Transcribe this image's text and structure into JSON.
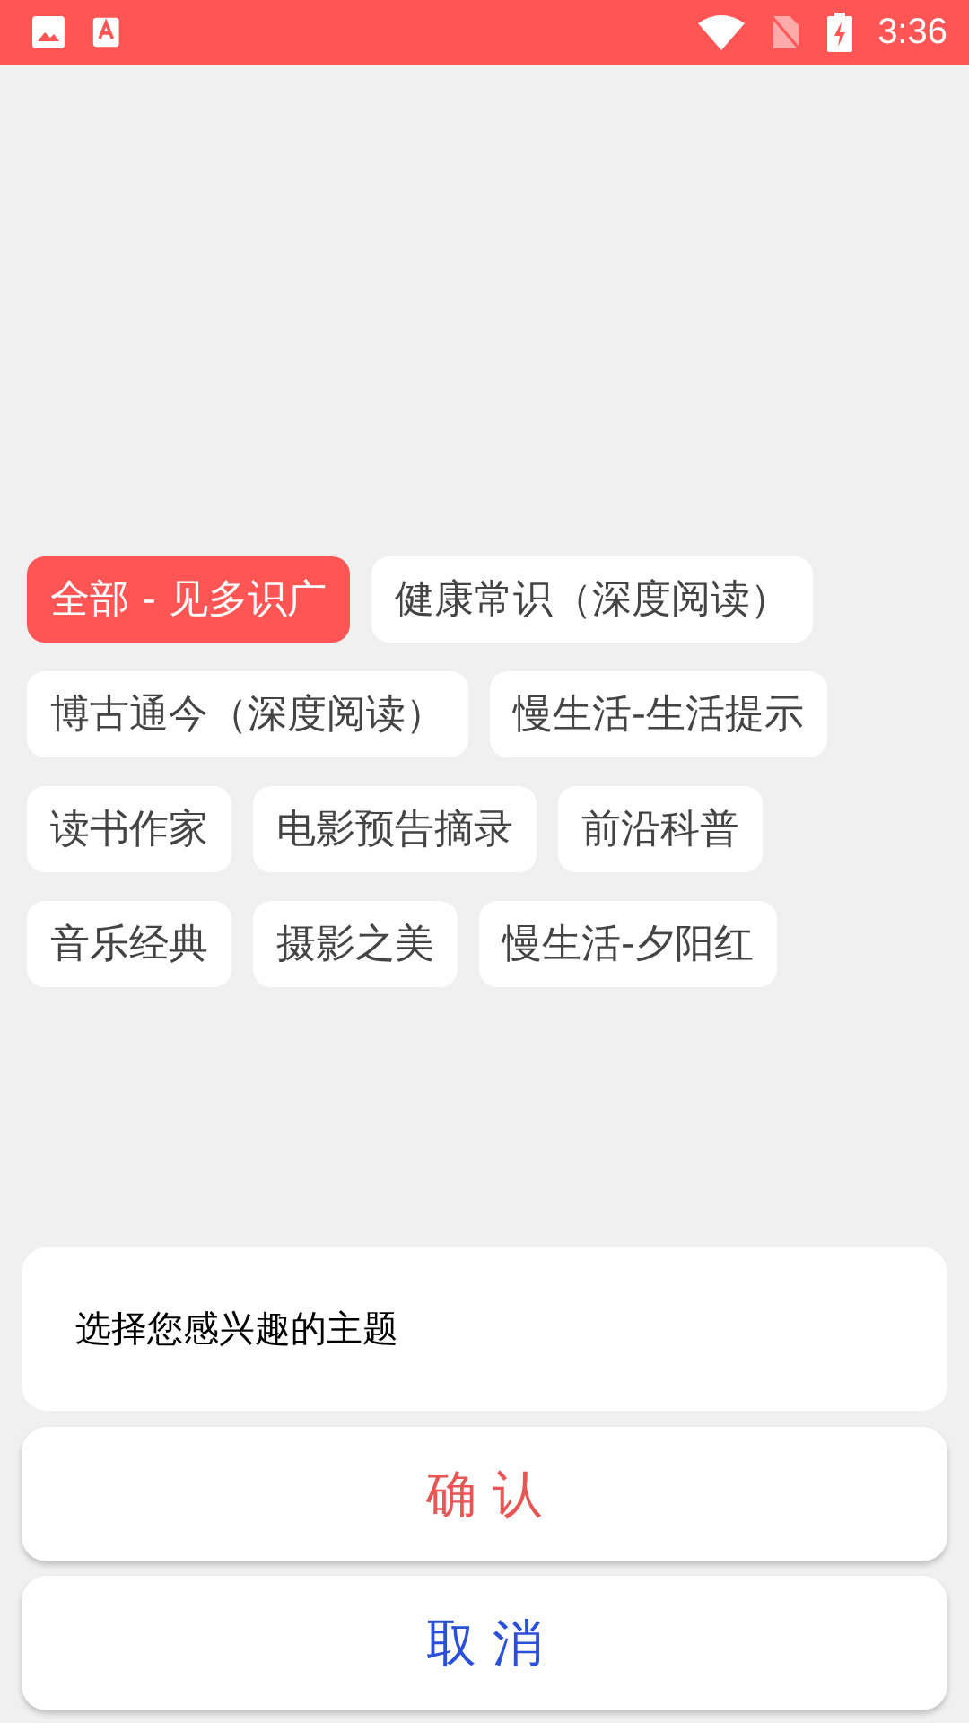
{
  "status_bar": {
    "time": "3:36"
  },
  "topics": [
    {
      "label": "全部 - 见多识广",
      "selected": true
    },
    {
      "label": "健康常识（深度阅读）",
      "selected": false
    },
    {
      "label": "博古通今（深度阅读）",
      "selected": false
    },
    {
      "label": "慢生活-生活提示",
      "selected": false
    },
    {
      "label": "读书作家",
      "selected": false
    },
    {
      "label": "电影预告摘录",
      "selected": false
    },
    {
      "label": "前沿科普",
      "selected": false
    },
    {
      "label": "音乐经典",
      "selected": false
    },
    {
      "label": "摄影之美",
      "selected": false
    },
    {
      "label": "慢生活-夕阳红",
      "selected": false
    }
  ],
  "dialog": {
    "message": "选择您感兴趣的主题",
    "confirm": "确 认",
    "cancel": "取 消"
  }
}
